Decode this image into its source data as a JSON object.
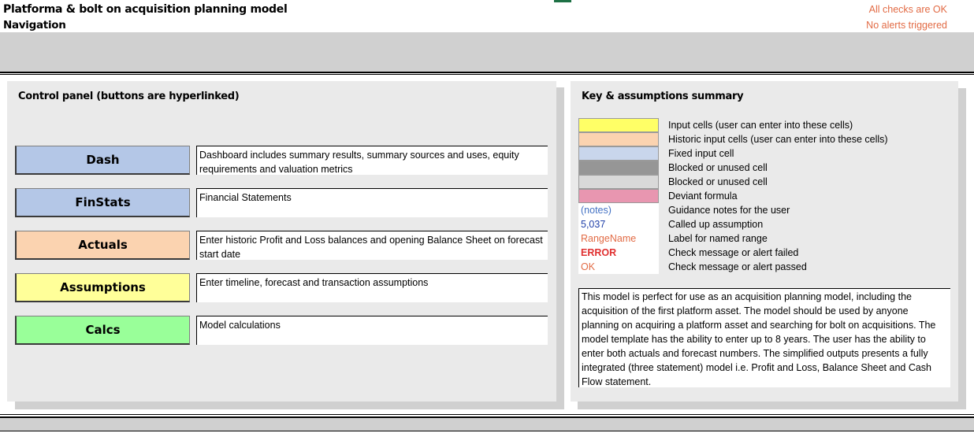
{
  "header": {
    "title": "Platforma & bolt on acquisition planning model",
    "subtitle": "Navigation",
    "status_checks": "All checks are OK",
    "status_alerts": "No alerts triggered"
  },
  "control_panel": {
    "title": "Control panel (buttons are hyperlinked)",
    "buttons": [
      {
        "label": "Dash",
        "color": "#B4C7E7",
        "description": "Dashboard includes summary results, summary sources and uses, equity requirements and valuation metrics"
      },
      {
        "label": "FinStats",
        "color": "#B4C7E7",
        "description": "Financial Statements"
      },
      {
        "label": "Actuals",
        "color": "#FBD3B0",
        "description": "Enter historic Profit and Loss balances and opening Balance Sheet on forecast start date"
      },
      {
        "label": "Assumptions",
        "color": "#FFFF99",
        "description": "Enter timeline, forecast and transaction assumptions"
      },
      {
        "label": "Calcs",
        "color": "#99FF99",
        "description": "Model calculations"
      }
    ]
  },
  "key_panel": {
    "title": "Key & assumptions summary",
    "items": [
      {
        "swatch": "#FFFF66",
        "label": "Input cells (user can enter into these cells)"
      },
      {
        "swatch": "#FBD3B0",
        "label": "Historic input cells (user can enter into these cells)"
      },
      {
        "swatch": "#C9D6EC",
        "label": "Fixed input cell"
      },
      {
        "swatch": "#969696",
        "label": "Blocked or unused cell"
      },
      {
        "swatch": "#D9D9D9",
        "label": "Blocked or unused cell"
      },
      {
        "swatch": "#E896B0",
        "label": "Deviant formula"
      },
      {
        "sample": "(notes)",
        "sample_color": "#4472C4",
        "sample_bold": false,
        "label": "Guidance notes for the user"
      },
      {
        "sample": "5,037",
        "sample_color": "#1F3FA8",
        "sample_bold": false,
        "label": "Called up assumption"
      },
      {
        "sample": "RangeName",
        "sample_color": "#E26B45",
        "sample_bold": false,
        "label": "Label for named range"
      },
      {
        "sample": "ERROR",
        "sample_color": "#E03030",
        "sample_bold": true,
        "label": "Check message or alert failed"
      },
      {
        "sample": "OK",
        "sample_color": "#E26B45",
        "sample_bold": false,
        "label": "Check message or alert passed"
      }
    ],
    "summary": "This model is perfect for use as an acquisition planning model, including the acquisition of the first platform asset. The model should be used by anyone planning on acquiring a platform asset and searching for bolt on acquisitions. The model template has the ability to enter up to 8 years. The user has the ability to enter both actuals and forecast numbers. The simplified outputs presents a fully integrated (three statement) model i.e. Profit and Loss, Balance Sheet and Cash Flow statement."
  }
}
